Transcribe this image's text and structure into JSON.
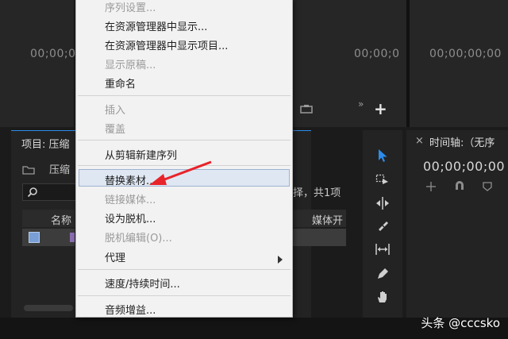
{
  "monitors": {
    "source_left_timecode": "00;00;0",
    "source_right_timecode": "00;00;0",
    "program_timecode": "00;00;00;00"
  },
  "project_panel": {
    "title": "项目: 压缩",
    "folder_label": "压缩",
    "search_placeholder": "",
    "selection_info": "择，共1项",
    "col_name": "名称",
    "col_media_start": "媒体开"
  },
  "timeline": {
    "title": "时间轴:（无序",
    "timecode": "00;00;00;00"
  },
  "context_menu": {
    "items": [
      {
        "label": "序列设置...",
        "enabled": false
      },
      {
        "label": "在资源管理器中显示...",
        "enabled": true
      },
      {
        "label": "在资源管理器中显示项目...",
        "enabled": true
      },
      {
        "label": "显示原稿...",
        "enabled": false
      },
      {
        "label": "重命名",
        "enabled": true
      },
      {
        "label": "插入",
        "enabled": false
      },
      {
        "label": "覆盖",
        "enabled": false
      },
      {
        "label": "从剪辑新建序列",
        "enabled": true
      },
      {
        "label": "替换素材...",
        "enabled": true,
        "highlighted": true
      },
      {
        "label": "链接媒体...",
        "enabled": false
      },
      {
        "label": "设为脱机...",
        "enabled": true
      },
      {
        "label": "脱机编辑(O)...",
        "enabled": false
      },
      {
        "label": "代理",
        "enabled": true,
        "submenu": true
      },
      {
        "label": "速度/持续时间...",
        "enabled": true
      },
      {
        "label": "音频增益...",
        "enabled": true
      }
    ]
  },
  "watermark": "头条 @cccsko",
  "colors": {
    "accent_blue": "#2d8ceb",
    "annotation_red": "#e8232a",
    "highlight_bg": "#dfe7f2"
  }
}
